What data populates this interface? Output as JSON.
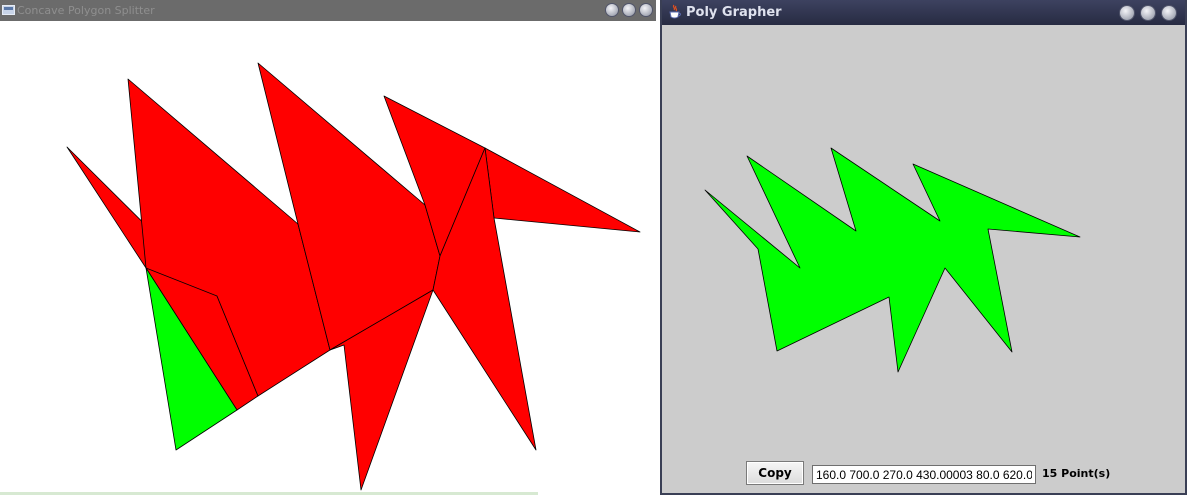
{
  "left_window": {
    "title": "Concave Polygon Splitter",
    "icon": "java-app-icon",
    "window_buttons": [
      "minimize",
      "maximize",
      "close"
    ],
    "colors": {
      "piece_fill": "#ff0000",
      "highlight_fill": "#00ff00",
      "background": "#ffffff",
      "edge": "#000000"
    }
  },
  "right_window": {
    "title": "Poly Grapher",
    "icon": "java-coffee-cup-icon",
    "window_buttons": [
      "minimize",
      "maximize",
      "close"
    ],
    "colors": {
      "polygon_fill": "#00ff00",
      "background": "#cccccc",
      "edge": "#000000"
    },
    "copy_button_label": "Copy",
    "coordinates_value": "160.0 700.0 270.0 430.00003 80.0 620.0",
    "point_count_label": "15 Point(s)"
  }
}
